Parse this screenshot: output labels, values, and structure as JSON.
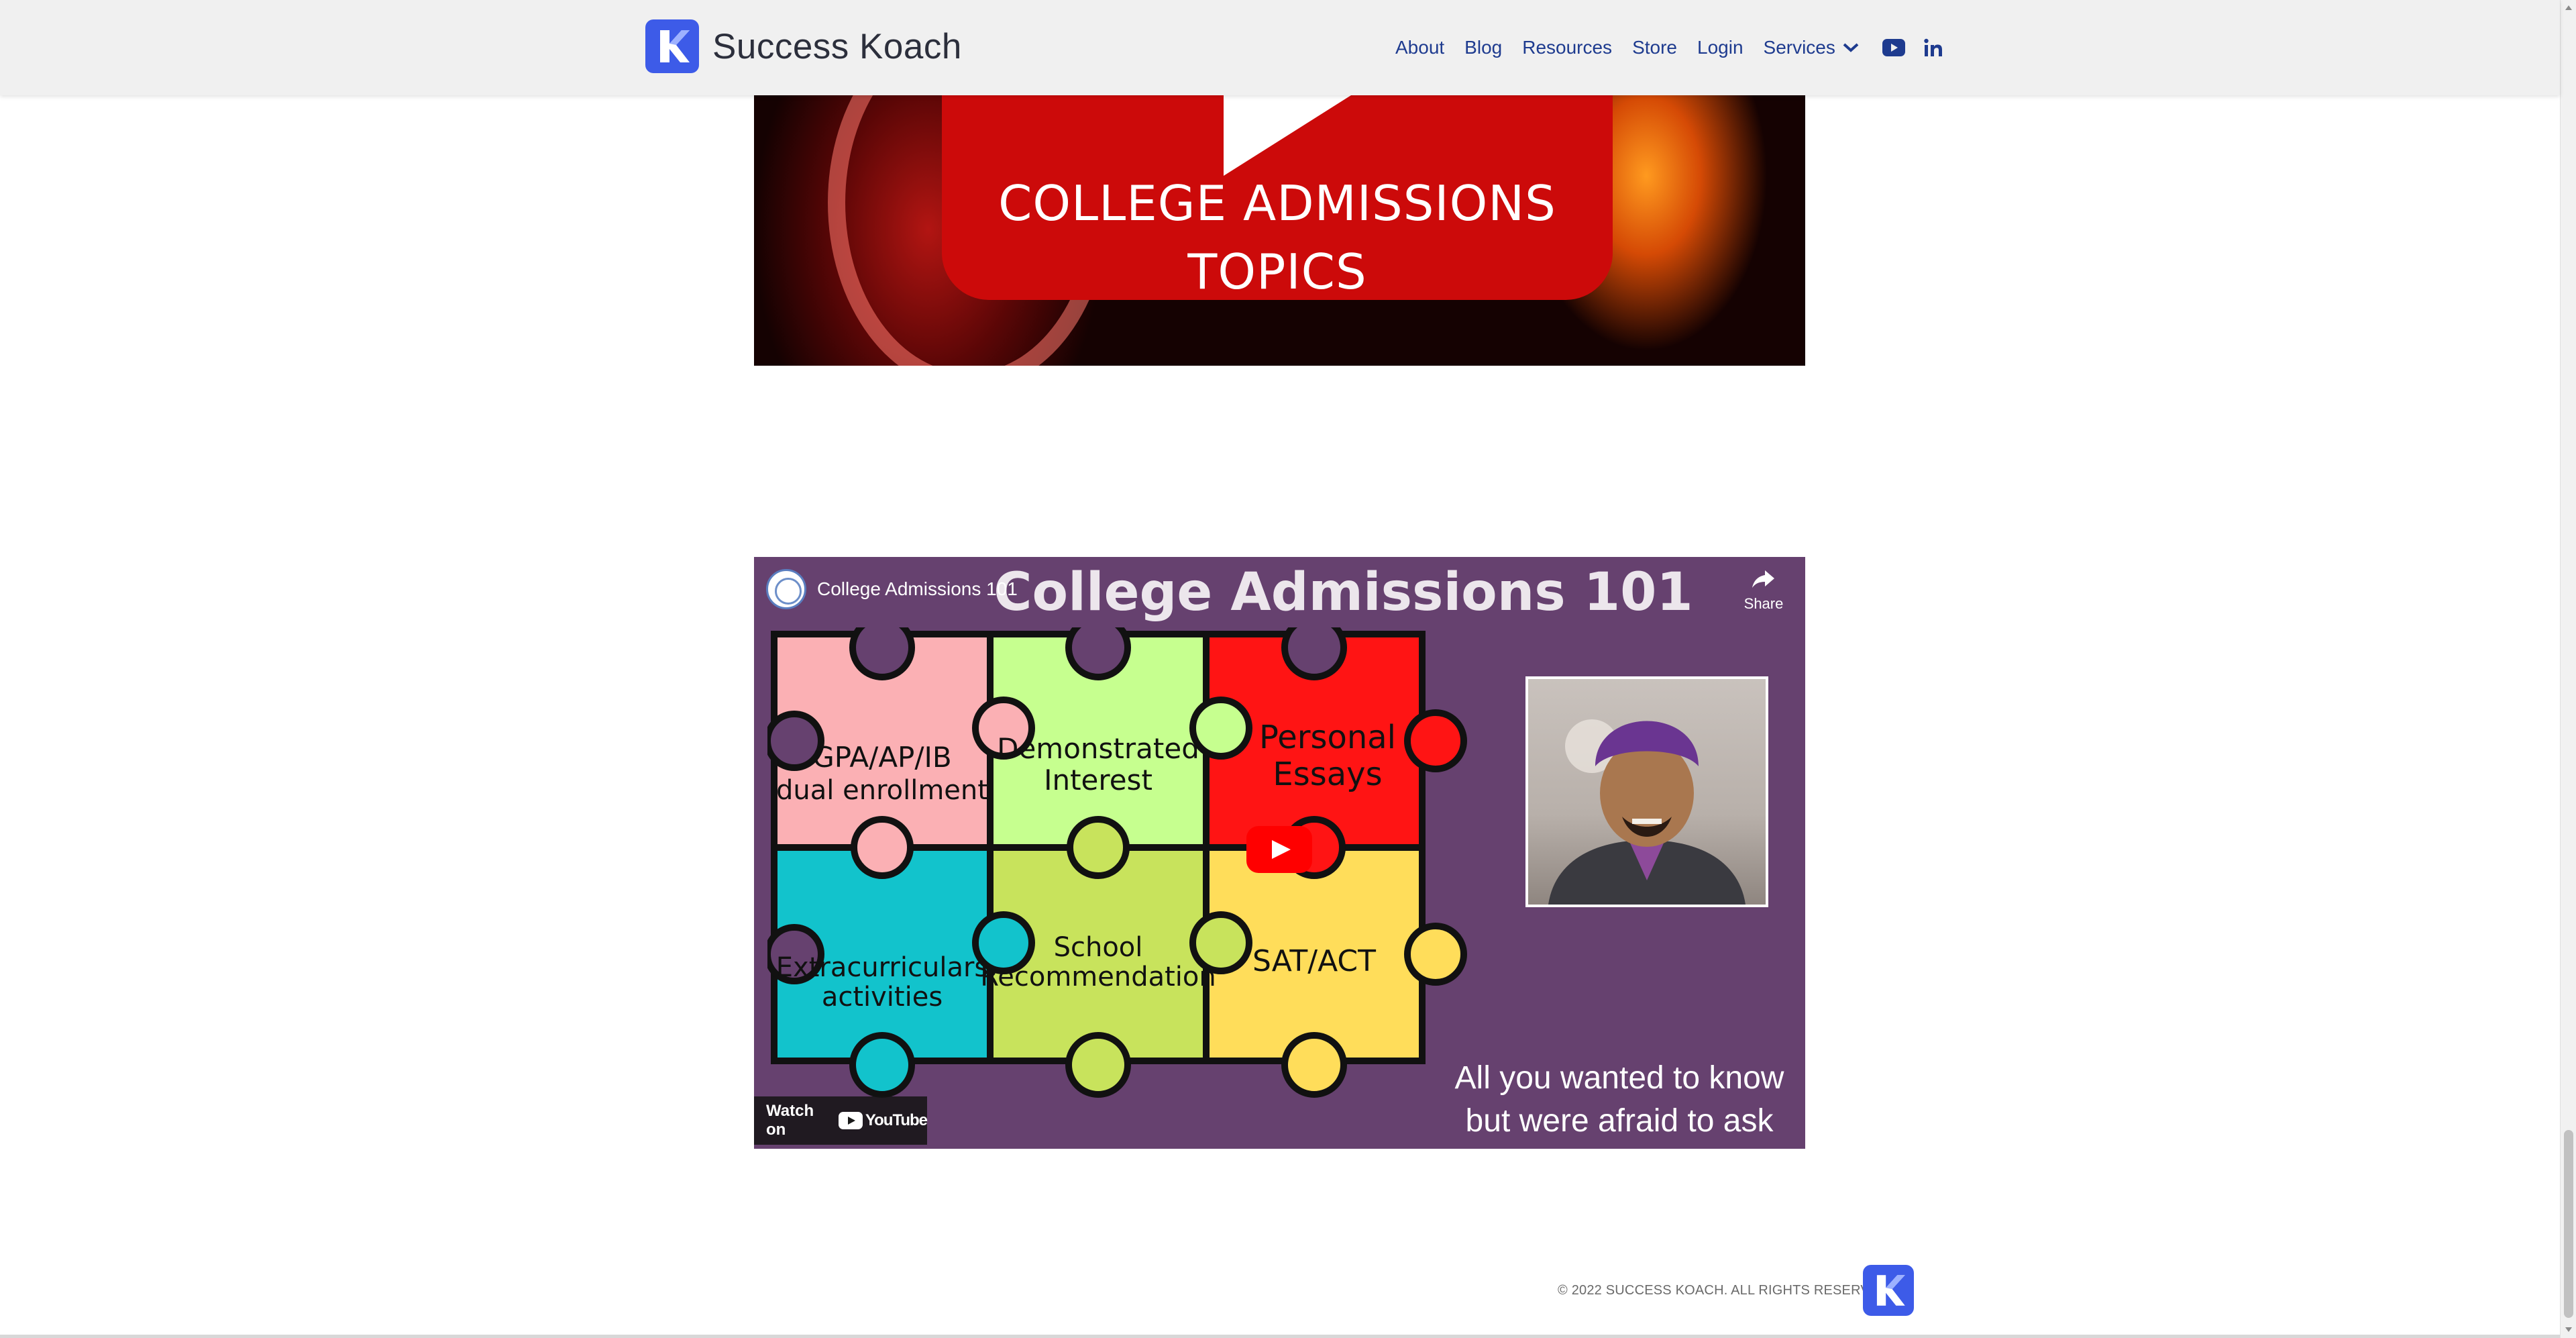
{
  "header": {
    "brand_name": "Success Koach",
    "nav": {
      "about": "About",
      "blog": "Blog",
      "resources": "Resources",
      "store": "Store",
      "login": "Login",
      "services": "Services"
    },
    "icons": [
      "youtube-icon",
      "linkedin-icon",
      "chevron-down-icon"
    ]
  },
  "top_image": {
    "line1": "COLLEGE ADMISSIONS",
    "line2": "TOPICS"
  },
  "video": {
    "channel_title": "College Admissions 101",
    "thumbnail_title": "College Admissions 101",
    "share_label": "Share",
    "puzzle_pieces": {
      "p1_l1": "GPA/AP/IB",
      "p1_l2": "dual enrollment",
      "p2_l1": "Demonstrated",
      "p2_l2": "Interest",
      "p3_l1": "Personal",
      "p3_l2": "Essays",
      "p4_l1": "Extracurriculars",
      "p4_l2": "activities",
      "p5_l1": "School",
      "p5_l2": "Recommendation",
      "p6_l1": "SAT/ACT"
    },
    "tagline_l1": "All you wanted to know",
    "tagline_l2": "but were afraid to ask",
    "watch_on_label": "Watch on",
    "youtube_wordmark": "YouTube"
  },
  "footer": {
    "copyright": "© 2022 SUCCESS KOACH. ALL RIGHTS RESERVED."
  },
  "colors": {
    "brand_blue": "#3d5be8",
    "nav_text": "#1e3b8f",
    "video_bg": "#66416f",
    "youtube_red": "#ff0000"
  }
}
